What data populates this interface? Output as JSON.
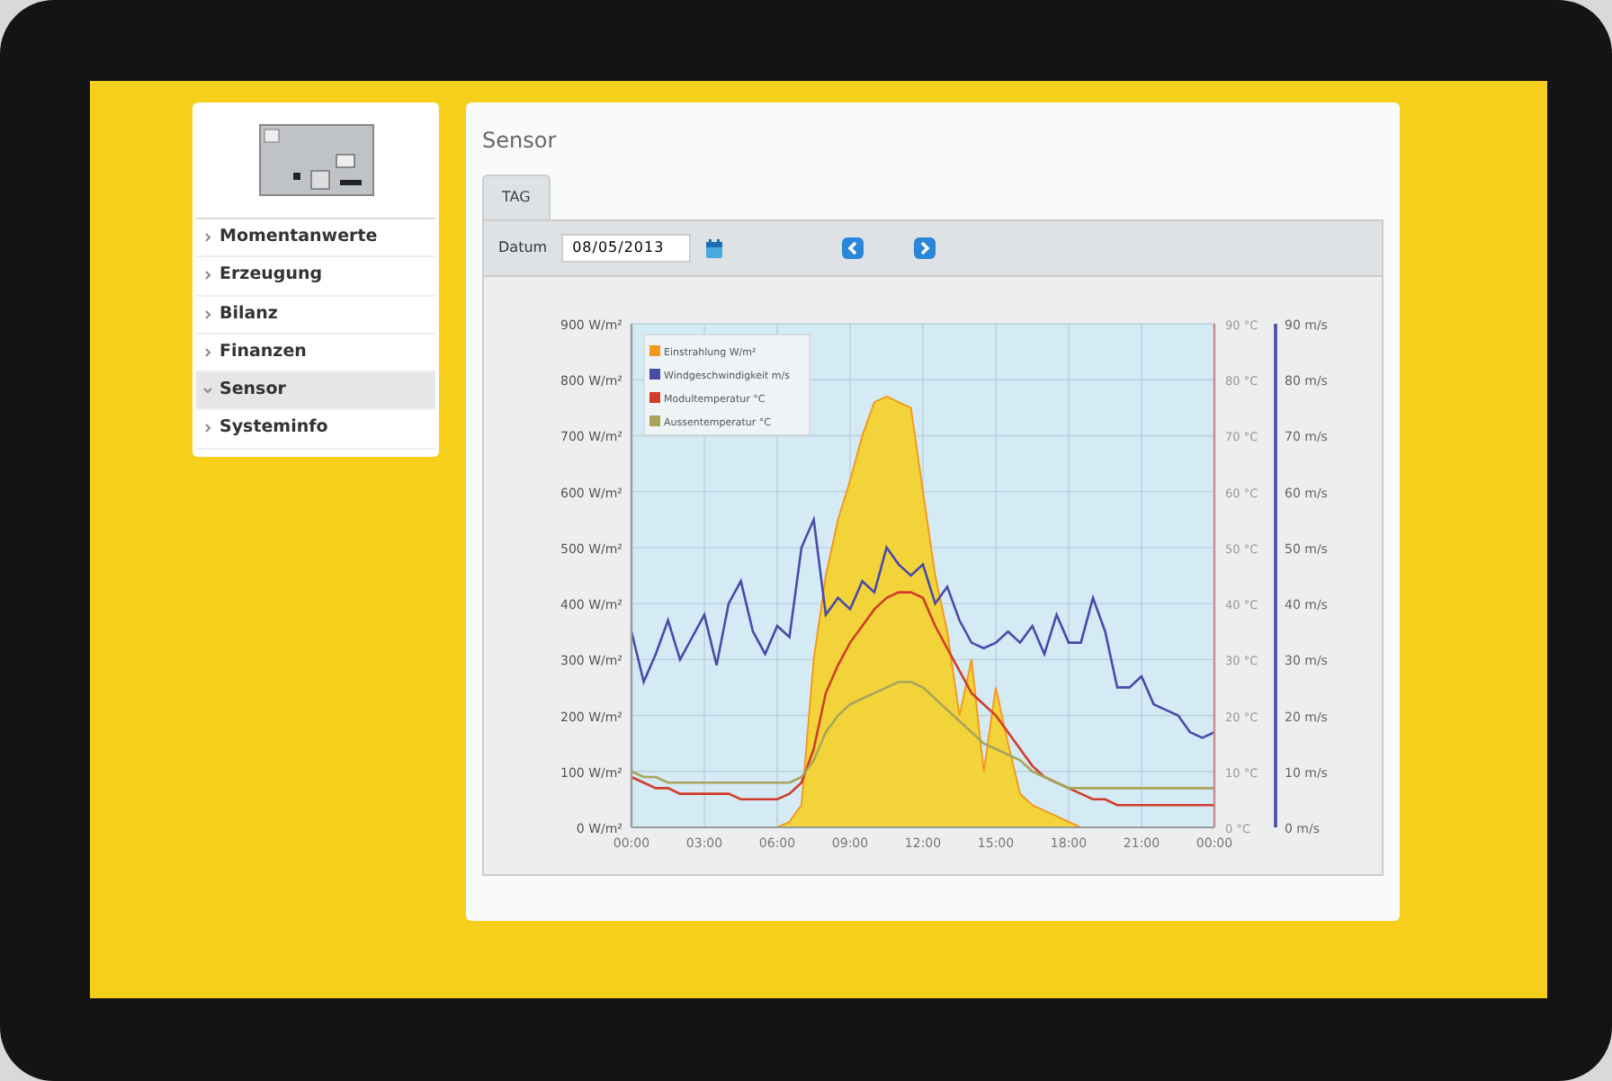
{
  "sidebar": {
    "items": [
      {
        "label": "Momentanwerte",
        "selected": false
      },
      {
        "label": "Erzeugung",
        "selected": false
      },
      {
        "label": "Bilanz",
        "selected": false
      },
      {
        "label": "Finanzen",
        "selected": false
      },
      {
        "label": "Sensor",
        "selected": true
      },
      {
        "label": "Systeminfo",
        "selected": false
      }
    ]
  },
  "main": {
    "title": "Sensor",
    "tabs": [
      {
        "label": "TAG",
        "selected": true
      }
    ],
    "date": {
      "label": "Datum",
      "value": "08/05/2013"
    },
    "chart_data": {
      "type": "line",
      "x": [
        0,
        0.5,
        1,
        1.5,
        2,
        2.5,
        3,
        3.5,
        4,
        4.5,
        5,
        5.5,
        6,
        6.5,
        7,
        7.5,
        8,
        8.5,
        9,
        9.5,
        10,
        10.5,
        11,
        11.5,
        12,
        12.5,
        13,
        13.5,
        14,
        14.5,
        15,
        15.5,
        16,
        16.5,
        17,
        17.5,
        18,
        18.5,
        19,
        19.5,
        20,
        20.5,
        21,
        21.5,
        22,
        22.5,
        23,
        23.5,
        24
      ],
      "xlim": [
        0,
        24
      ],
      "grid": true,
      "legend": true,
      "xticks": [
        {
          "value": 0,
          "label": "00:00"
        },
        {
          "value": 3,
          "label": "03:00"
        },
        {
          "value": 6,
          "label": "06:00"
        },
        {
          "value": 9,
          "label": "09:00"
        },
        {
          "value": 12,
          "label": "12:00"
        },
        {
          "value": 15,
          "label": "15:00"
        },
        {
          "value": 18,
          "label": "18:00"
        },
        {
          "value": 21,
          "label": "21:00"
        },
        {
          "value": 24,
          "label": "00:00"
        }
      ],
      "ylim": [
        0,
        900
      ],
      "yticks": [
        {
          "value": 0,
          "label": "0 W/m²"
        },
        {
          "value": 100,
          "label": "100 W/m²"
        },
        {
          "value": 200,
          "label": "200 W/m²"
        },
        {
          "value": 300,
          "label": "300 W/m²"
        },
        {
          "value": 400,
          "label": "400 W/m²"
        },
        {
          "value": 500,
          "label": "500 W/m²"
        },
        {
          "value": 600,
          "label": "600 W/m²"
        },
        {
          "value": 700,
          "label": "700 W/m²"
        },
        {
          "value": 800,
          "label": "800 W/m²"
        },
        {
          "value": 900,
          "label": "900 W/m²"
        }
      ],
      "y2lim": [
        0,
        90
      ],
      "y2ticks": [
        {
          "value": 0,
          "label": "0 °C"
        },
        {
          "value": 10,
          "label": "10 °C"
        },
        {
          "value": 20,
          "label": "20 °C"
        },
        {
          "value": 30,
          "label": "30 °C"
        },
        {
          "value": 40,
          "label": "40 °C"
        },
        {
          "value": 50,
          "label": "50 °C"
        },
        {
          "value": 60,
          "label": "60 °C"
        },
        {
          "value": 70,
          "label": "70 °C"
        },
        {
          "value": 80,
          "label": "80 °C"
        },
        {
          "value": 90,
          "label": "90 °C"
        }
      ],
      "y3lim": [
        0,
        90
      ],
      "y3ticks": [
        {
          "value": 0,
          "label": "0 m/s"
        },
        {
          "value": 10,
          "label": "10 m/s"
        },
        {
          "value": 20,
          "label": "20 m/s"
        },
        {
          "value": 30,
          "label": "30 m/s"
        },
        {
          "value": 40,
          "label": "40 m/s"
        },
        {
          "value": 50,
          "label": "50 m/s"
        },
        {
          "value": 60,
          "label": "60 m/s"
        },
        {
          "value": 70,
          "label": "70 m/s"
        },
        {
          "value": 80,
          "label": "80 m/s"
        },
        {
          "value": 90,
          "label": "90 m/s"
        }
      ],
      "series": [
        {
          "name": "Einstrahlung W/m²",
          "color": "#f39a1e",
          "type": "area",
          "axis": "y",
          "values": [
            0,
            0,
            0,
            0,
            0,
            0,
            0,
            0,
            0,
            0,
            0,
            0,
            0,
            10,
            40,
            300,
            450,
            550,
            620,
            700,
            760,
            770,
            760,
            750,
            600,
            450,
            350,
            200,
            300,
            100,
            250,
            150,
            60,
            40,
            30,
            20,
            10,
            0,
            0,
            0,
            0,
            0,
            0,
            0,
            0,
            0,
            0,
            0,
            0
          ]
        },
        {
          "name": "Windgeschwindigkeit m/s",
          "color": "#4a4aa8",
          "type": "line",
          "axis": "y3",
          "values": [
            35,
            26,
            31,
            37,
            30,
            34,
            38,
            29,
            40,
            44,
            35,
            31,
            36,
            34,
            50,
            55,
            38,
            41,
            39,
            44,
            42,
            50,
            47,
            45,
            47,
            40,
            43,
            37,
            33,
            32,
            33,
            35,
            33,
            36,
            31,
            38,
            33,
            33,
            41,
            35,
            25,
            25,
            27,
            22,
            21,
            20,
            17,
            16,
            17
          ]
        },
        {
          "name": "Modultemperatur °C",
          "color": "#d23b2a",
          "type": "line",
          "axis": "y2",
          "values": [
            9,
            8,
            7,
            7,
            6,
            6,
            6,
            6,
            6,
            5,
            5,
            5,
            5,
            6,
            8,
            14,
            24,
            29,
            33,
            36,
            39,
            41,
            42,
            42,
            41,
            36,
            32,
            28,
            24,
            22,
            20,
            17,
            14,
            11,
            9,
            8,
            7,
            6,
            5,
            5,
            4,
            4,
            4,
            4,
            4,
            4,
            4,
            4,
            4
          ]
        },
        {
          "name": "Aussentemperatur °C",
          "color": "#a9a45a",
          "type": "line",
          "axis": "y2",
          "values": [
            10,
            9,
            9,
            8,
            8,
            8,
            8,
            8,
            8,
            8,
            8,
            8,
            8,
            8,
            9,
            12,
            17,
            20,
            22,
            23,
            24,
            25,
            26,
            26,
            25,
            23,
            21,
            19,
            17,
            15,
            14,
            13,
            12,
            10,
            9,
            8,
            7,
            7,
            7,
            7,
            7,
            7,
            7,
            7,
            7,
            7,
            7,
            7,
            7
          ]
        }
      ]
    }
  }
}
